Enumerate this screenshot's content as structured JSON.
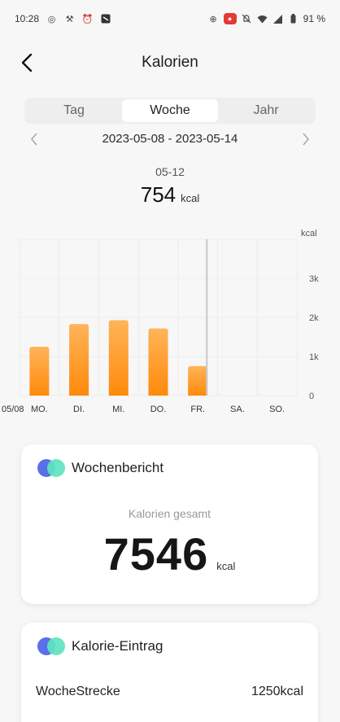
{
  "status_bar": {
    "time": "10:28",
    "battery": "91 %",
    "icons_left": [
      "target-icon",
      "signal-tool-icon",
      "alarm-icon",
      "app-icon"
    ],
    "icons_right": [
      "location-icon",
      "record-icon",
      "mute-icon",
      "wifi-icon",
      "cell-icon",
      "battery-icon"
    ]
  },
  "header": {
    "title": "Kalorien",
    "back_icon": "chevron-left-icon"
  },
  "tabs": [
    {
      "label": "Tag",
      "active": false
    },
    {
      "label": "Woche",
      "active": true
    },
    {
      "label": "Jahr",
      "active": false
    }
  ],
  "date_nav": {
    "range": "2023-05-08 - 2023-05-14"
  },
  "selected": {
    "date": "05-12",
    "value": "754",
    "unit": "kcal"
  },
  "chart_data": {
    "type": "bar",
    "unit_label": "kcal",
    "first_date_label": "05/08",
    "categories": [
      "MO.",
      "DI.",
      "MI.",
      "DO.",
      "FR.",
      "SA.",
      "SO."
    ],
    "values": [
      1250,
      1830,
      1930,
      1720,
      754,
      0,
      0
    ],
    "ylim": [
      0,
      4000
    ],
    "yticks": [
      0,
      1000,
      2000,
      3000
    ],
    "ytick_labels": [
      "0",
      "1k",
      "2k",
      "3k"
    ],
    "selected_index": 4,
    "bar_color_top": "#ffb45a",
    "bar_color_bottom": "#ff8a0a",
    "grid": true
  },
  "weekly_report": {
    "title": "Wochenbericht",
    "total_label": "Kalorien gesamt",
    "total_value": "7546",
    "total_unit": "kcal"
  },
  "calorie_entries": {
    "title": "Kalorie-Eintrag",
    "rows": [
      {
        "label": "WocheStrecke",
        "value": "1250kcal"
      }
    ]
  },
  "colors": {
    "accent_blue": "#5b6fe8",
    "accent_mint": "#5fe3bf",
    "background": "#f7f7f8"
  }
}
